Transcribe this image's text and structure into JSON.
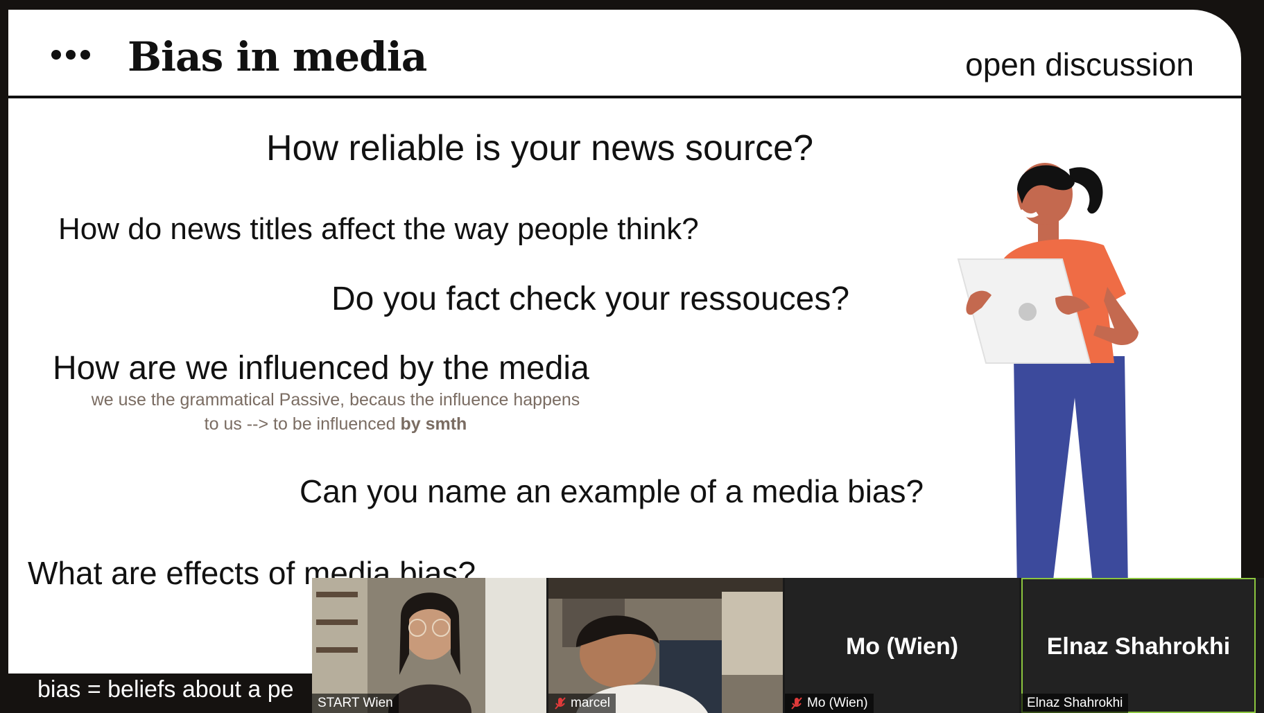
{
  "slide": {
    "title": "Bias in media",
    "subtitle": "open discussion",
    "questions": [
      "How reliable is your news source?",
      "How do news titles affect the way people think?",
      "Do you fact check your ressouces?",
      "How are we influenced by the media",
      "Can you name an example of a media bias?",
      "What are effects of media bias?"
    ],
    "note_line1": "we use the grammatical Passive, becaus the influence happens",
    "note_line2_prefix": "to us --> to be influenced ",
    "note_line2_bold": "by smth"
  },
  "caption": "bias = beliefs about  a pe",
  "participants": [
    {
      "name": "START Wien",
      "muted": false,
      "video": true
    },
    {
      "name": "marcel",
      "muted": true,
      "video": true
    },
    {
      "name": "Mo (Wien)",
      "display_name": "Mo (Wien)",
      "muted": true,
      "video": false
    },
    {
      "name": "Elnaz Shahrokhi",
      "display_name": "Elnaz Shahrokhi",
      "muted": false,
      "video": false,
      "active_speaker": true
    }
  ],
  "colors": {
    "background": "#151210",
    "slide": "#ffffff",
    "text": "#111111",
    "note": "#7a6c62",
    "shirt": "#ef6c45",
    "pants": "#3c4a9c",
    "skin": "#c4694f",
    "active_border": "#8cc63f",
    "muted_icon": "#e03a3a"
  },
  "icons": [
    "more-dots-icon",
    "muted-mic-icon"
  ]
}
